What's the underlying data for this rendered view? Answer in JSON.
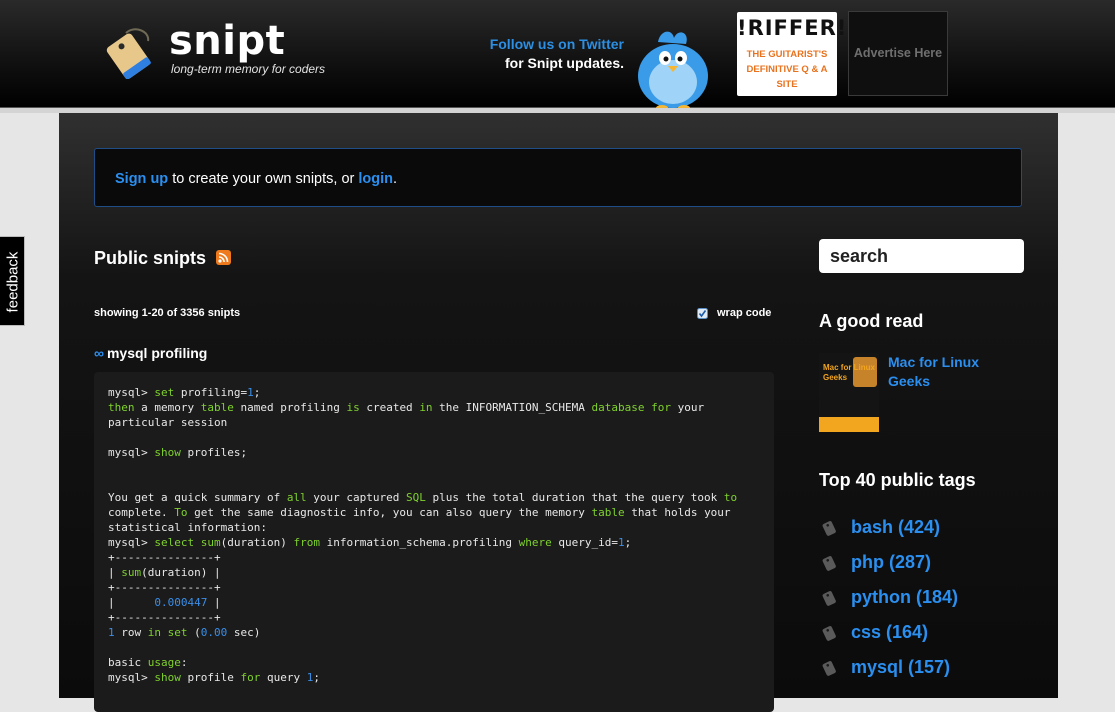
{
  "header": {
    "logo_text": "snipt",
    "tagline": "long-term memory for coders",
    "twitter_line1": "Follow us on Twitter",
    "twitter_line2": "for Snipt updates.",
    "ad_riffer_logo": "!RIFFER!",
    "ad_riffer_text": "THE GUITARIST'S DEFINITIVE Q & A SITE",
    "advertise_text": "Advertise Here"
  },
  "signup": {
    "signup_link": "Sign up",
    "middle_text": " to create your own snipts, or ",
    "login_link": "login",
    "end_text": "."
  },
  "snipts": {
    "title": "Public snipts",
    "showing": "showing 1-20 of 3356 snipts",
    "wrap_label": "wrap code",
    "wrap_checked": true,
    "first_title_icon": "∞",
    "first_title": "mysql profiling"
  },
  "code_lines": [
    [
      [
        "mysql> ",
        "t"
      ],
      [
        "set",
        "k"
      ],
      [
        " profiling=",
        "t"
      ],
      [
        "1",
        "n"
      ],
      [
        ";",
        "t"
      ]
    ],
    [
      [
        "then",
        "k"
      ],
      [
        " a memory ",
        "t"
      ],
      [
        "table",
        "k"
      ],
      [
        " named profiling ",
        "t"
      ],
      [
        "is",
        "k"
      ],
      [
        " created ",
        "t"
      ],
      [
        "in",
        "k"
      ],
      [
        " the INFORMATION_SCHEMA ",
        "t"
      ],
      [
        "database",
        "k"
      ],
      [
        " ",
        "t"
      ],
      [
        "for",
        "k"
      ],
      [
        " your",
        "t"
      ]
    ],
    [
      [
        "particular session",
        "t"
      ]
    ],
    [],
    [
      [
        "mysql> ",
        "t"
      ],
      [
        "show",
        "k"
      ],
      [
        " profiles;",
        "t"
      ]
    ],
    [],
    [],
    [
      [
        "You get a quick summary of ",
        "t"
      ],
      [
        "all",
        "k"
      ],
      [
        " your captured ",
        "t"
      ],
      [
        "SQL",
        "k"
      ],
      [
        " plus the total duration that the query took ",
        "t"
      ],
      [
        "to",
        "k"
      ]
    ],
    [
      [
        "complete. ",
        "t"
      ],
      [
        "To",
        "k"
      ],
      [
        " get the same diagnostic info, you can also query the memory ",
        "t"
      ],
      [
        "table",
        "k"
      ],
      [
        " that holds your",
        "t"
      ]
    ],
    [
      [
        "statistical information:",
        "t"
      ]
    ],
    [
      [
        "mysql> ",
        "t"
      ],
      [
        "select",
        "k"
      ],
      [
        " ",
        "t"
      ],
      [
        "sum",
        "k"
      ],
      [
        "(duration) ",
        "t"
      ],
      [
        "from",
        "k"
      ],
      [
        " information_schema.profiling ",
        "t"
      ],
      [
        "where",
        "k"
      ],
      [
        " query_id=",
        "t"
      ],
      [
        "1",
        "n"
      ],
      [
        ";",
        "t"
      ]
    ],
    [
      [
        "+---------------+",
        "t"
      ]
    ],
    [
      [
        "| ",
        "t"
      ],
      [
        "sum",
        "k"
      ],
      [
        "(duration) |",
        "t"
      ]
    ],
    [
      [
        "+---------------+",
        "t"
      ]
    ],
    [
      [
        "|      ",
        "t"
      ],
      [
        "0.000447",
        "n"
      ],
      [
        " |",
        "t"
      ]
    ],
    [
      [
        "+---------------+",
        "t"
      ]
    ],
    [
      [
        "1",
        "n"
      ],
      [
        " row ",
        "t"
      ],
      [
        "in",
        "k"
      ],
      [
        " ",
        "t"
      ],
      [
        "set",
        "k"
      ],
      [
        " (",
        "t"
      ],
      [
        "0.00",
        "n"
      ],
      [
        " sec)",
        "t"
      ]
    ],
    [],
    [
      [
        "basic ",
        "t"
      ],
      [
        "usage",
        "k"
      ],
      [
        ":",
        "t"
      ]
    ],
    [
      [
        "mysql> ",
        "t"
      ],
      [
        "show",
        "k"
      ],
      [
        " profile ",
        "t"
      ],
      [
        "for",
        "k"
      ],
      [
        " query ",
        "t"
      ],
      [
        "1",
        "n"
      ],
      [
        ";",
        "t"
      ]
    ]
  ],
  "sidebar": {
    "search_placeholder": "search",
    "good_read_title": "A good read",
    "book_link": "Mac for Linux Geeks",
    "book_cover_text": "Mac for Linux Geeks",
    "tags_title": "Top 40 public tags",
    "tags": [
      {
        "label": "bash (424)"
      },
      {
        "label": "php (287)"
      },
      {
        "label": "python (184)"
      },
      {
        "label": "css (164)"
      },
      {
        "label": "mysql (157)"
      }
    ]
  },
  "feedback_label": "feedback",
  "colors": {
    "link": "#2b8ff0",
    "code_keyword": "#7fd12f",
    "code_number": "#3b8ee8",
    "advertise_text": "#6f6f6f",
    "riffer_orange": "#e8731e"
  },
  "icons": {
    "logo": "price-tag-icon",
    "twitter": "twitter-bird-icon",
    "rss": "rss-icon",
    "wrap": "checkbox-icon",
    "tag": "tag-icon"
  }
}
